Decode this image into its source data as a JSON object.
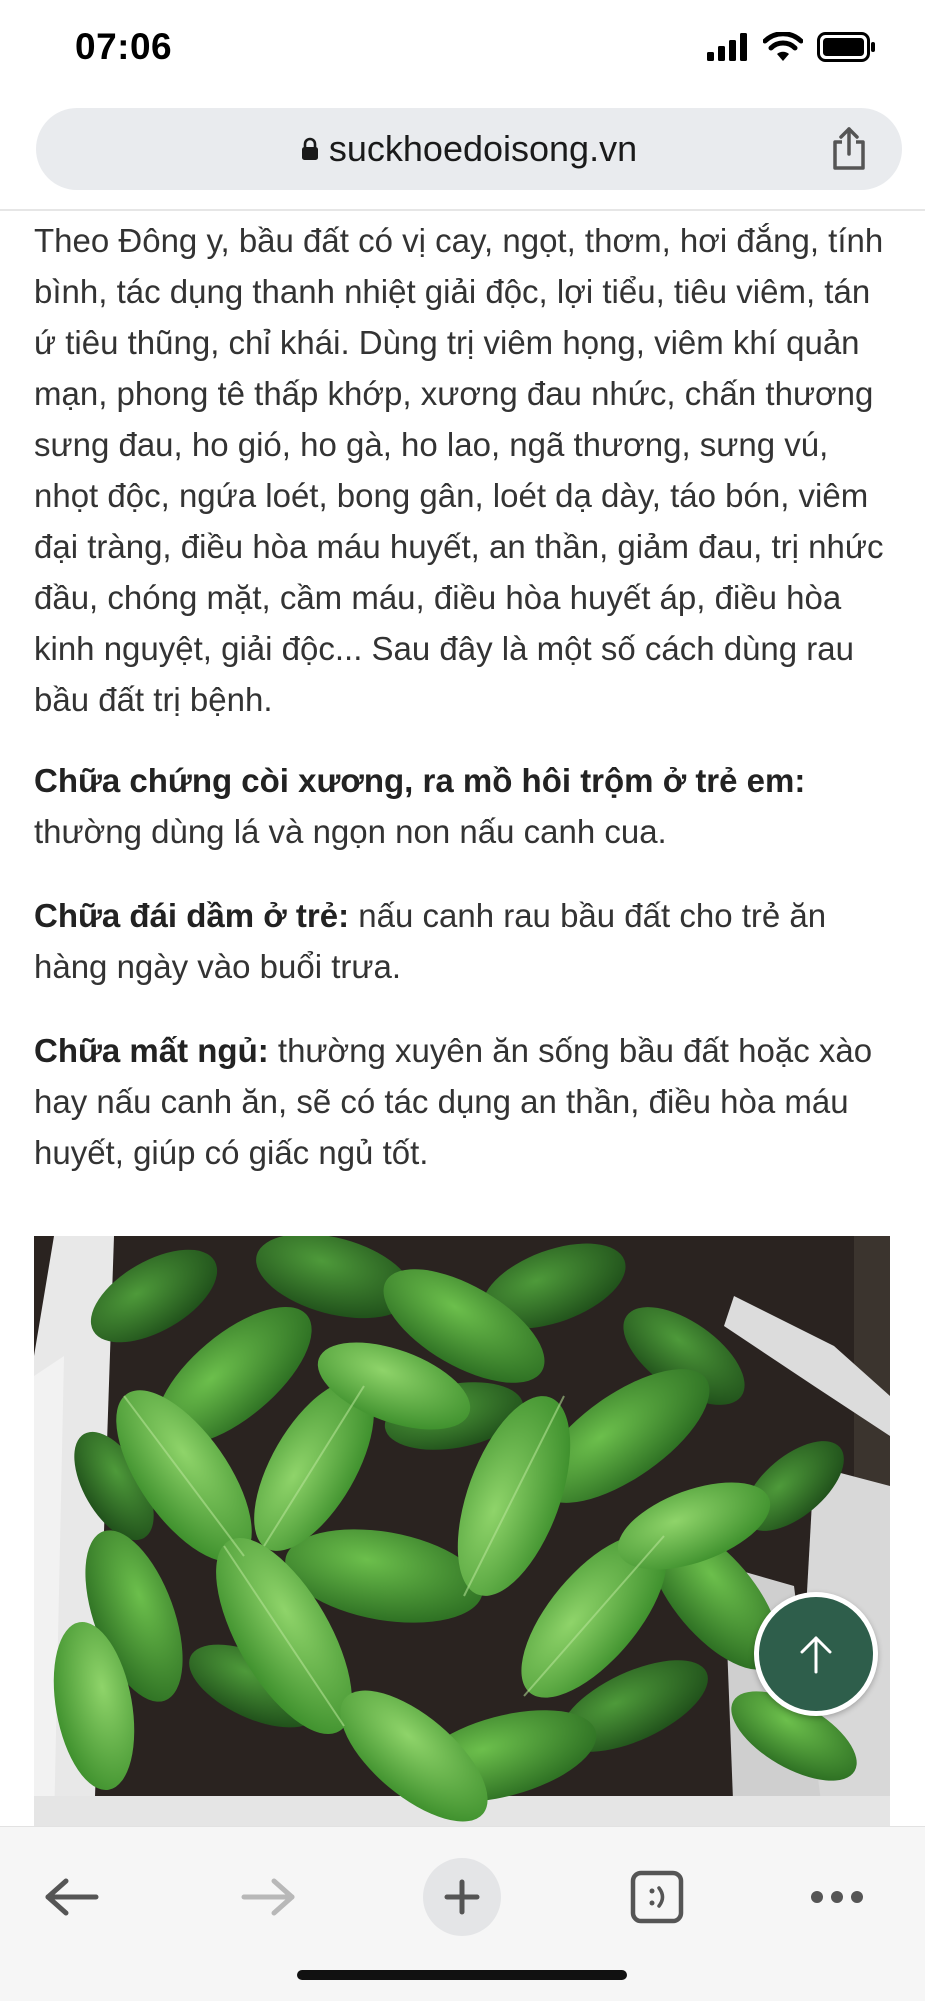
{
  "status": {
    "time": "07:06"
  },
  "browser": {
    "url": "suckhoedoisong.vn"
  },
  "article": {
    "intro": "Theo Đông y, bầu đất có vị cay, ngọt, thơm, hơi đắng, tính bình, tác dụng thanh nhiệt giải độc, lợi tiểu, tiêu viêm, tán ứ tiêu thũng, chỉ khái. Dùng trị viêm họng, viêm khí quản mạn, phong tê thấp khớp, xương đau nhức, chấn thương sưng đau, ho gió, ho gà, ho lao, ngã thương, sưng vú, nhọt độc, ngứa loét, bong gân, loét dạ dày, táo bón, viêm đại tràng, điều hòa máu huyết, an thần, giảm đau, trị nhức đầu, chóng mặt, cầm máu, điều hòa huyết áp, điều hòa kinh nguyệt, giải độc... Sau đây là một số cách dùng rau bầu đất trị bệnh.",
    "remedies": [
      {
        "title": "Chữa chứng còi xương, ra mồ hôi trộm ở trẻ em:",
        "text": " thường dùng lá và ngọn non nấu canh cua."
      },
      {
        "title": "Chữa đái dầm ở trẻ:",
        "text": " nấu canh rau bầu đất cho trẻ ăn hàng ngày vào buổi trưa."
      },
      {
        "title": "Chữa mất ngủ:",
        "text": " thường xuyên ăn sống bầu đất hoặc xào hay nấu canh ăn, sẽ có tác dụng an thần, điều hòa máu huyết, giúp có giấc ngủ tốt."
      }
    ]
  },
  "icons": {
    "back": "arrow-left-icon",
    "forward": "arrow-right-icon",
    "new_tab": "plus-icon",
    "tabs": "tab-switcher-icon",
    "menu": "more-icon",
    "scroll_top": "arrow-up-icon",
    "share": "share-icon"
  },
  "colors": {
    "scroll_top_bg": "#2e5e4b",
    "url_bar_bg": "#e9ebee"
  }
}
